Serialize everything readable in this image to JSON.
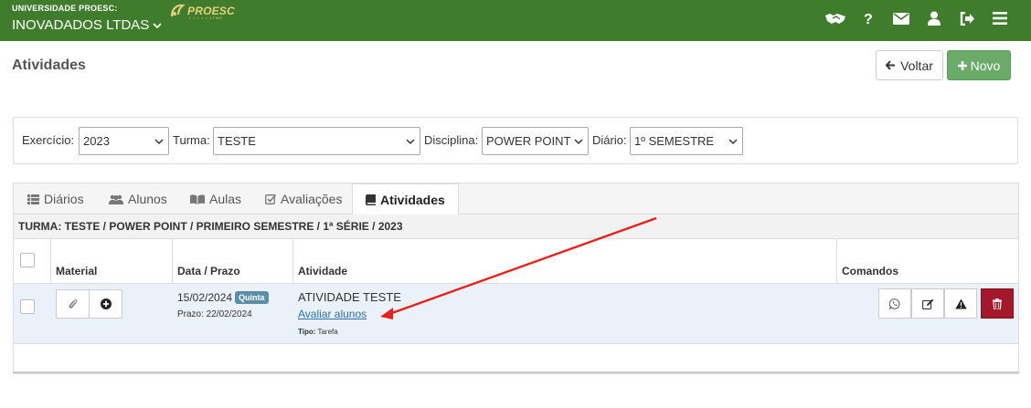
{
  "header": {
    "university": "UNIVERSIDADE PROESC:",
    "company": "INOVADADOS LTDAS",
    "logo_word": "PROESC",
    "logo_sub": "• • • • • LTME",
    "icons": [
      "handshake-icon",
      "question-icon",
      "envelope-icon",
      "user-icon",
      "logout-icon",
      "menu-icon"
    ]
  },
  "page": {
    "title": "Atividades",
    "voltar_label": "Voltar",
    "novo_label": "Novo"
  },
  "filters": {
    "exercicio_label": "Exercício:",
    "exercicio_value": "2023",
    "turma_label": "Turma:",
    "turma_value": "TESTE",
    "disciplina_label": "Disciplina:",
    "disciplina_value": "POWER POINT",
    "diario_label": "Diário:",
    "diario_value": "1º SEMESTRE"
  },
  "tabs": [
    {
      "label": "Diários",
      "icon": "list-icon"
    },
    {
      "label": "Alunos",
      "icon": "users-icon"
    },
    {
      "label": "Aulas",
      "icon": "book-open-icon"
    },
    {
      "label": "Avaliações",
      "icon": "check-square-icon"
    },
    {
      "label": "Atividades",
      "icon": "book-icon",
      "active": true
    }
  ],
  "breadcrumb": "TURMA: TESTE / POWER POINT / PRIMEIRO SEMESTRE / 1ª SÉRIE / 2023",
  "table": {
    "columns": [
      "Material",
      "Data / Prazo",
      "Atividade",
      "Comandos"
    ],
    "rows": [
      {
        "date": "15/02/2024",
        "weekday": "Quinta",
        "prazo": "Prazo: 22/02/2024",
        "title": "ATIVIDADE TESTE",
        "link": "Avaliar alunos",
        "tipo_label": "Tipo:",
        "tipo_value": "Tarefa"
      }
    ]
  },
  "colors": {
    "topbar": "#3f7d2c",
    "novo_button": "#6aab6a",
    "danger": "#a3182a",
    "badge": "#5b8fa8",
    "link": "#2a6fb0",
    "annotation_arrow": "#e8201a"
  }
}
